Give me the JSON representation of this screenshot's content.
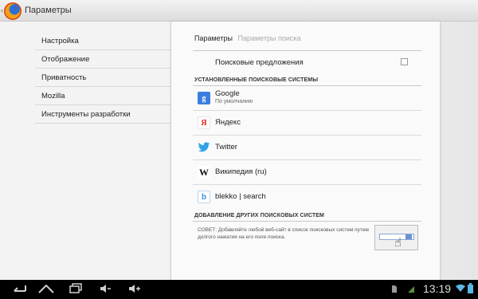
{
  "actionbar": {
    "title": "Параметры",
    "up_icon": "chevron-left-icon",
    "logo_icon": "firefox-logo-icon"
  },
  "nav": {
    "items": [
      {
        "label": "Настройка"
      },
      {
        "label": "Отображение"
      },
      {
        "label": "Приватность"
      },
      {
        "label": "Mozilla"
      },
      {
        "label": "Инструменты разработки"
      }
    ]
  },
  "panel": {
    "breadcrumb": {
      "current": "Параметры",
      "child": "Параметры поиска"
    },
    "suggestions": {
      "label": "Поисковые предложения",
      "checked": false
    },
    "installed_header": "УСТАНОВЛЕННЫЕ ПОИСКОВЫЕ СИСТЕМЫ",
    "engines": [
      {
        "name": "Google",
        "sub": "По умолчанию",
        "icon": "google-icon",
        "glyph": "g"
      },
      {
        "name": "Яндекс",
        "sub": "",
        "icon": "yandex-icon",
        "glyph": "Я"
      },
      {
        "name": "Twitter",
        "sub": "",
        "icon": "twitter-icon",
        "glyph": "🐦"
      },
      {
        "name": "Википедия (ru)",
        "sub": "",
        "icon": "wikipedia-icon",
        "glyph": "W"
      },
      {
        "name": "blekko | search",
        "sub": "",
        "icon": "blekko-icon",
        "glyph": "b"
      }
    ],
    "add_header": "ДОБАВЛЕНИЕ ДРУГИХ ПОИСКОВЫХ СИСТЕМ",
    "tip": "СОВЕТ: Добавляйте любой веб-сайт в список поисковых систем путем долгого нажатия на его поле поиска.",
    "tip_illustration": "long-press-search-illustration"
  },
  "systembar": {
    "icons": [
      "back-icon",
      "home-icon",
      "recent-apps-icon",
      "volume-down-icon",
      "volume-up-icon",
      "sd-card-icon",
      "signal-icon",
      "wifi-icon",
      "battery-icon"
    ],
    "time": "13:19"
  },
  "colors": {
    "accent": "#2fa3e6",
    "google_blue": "#3b7de0",
    "yandex_red": "#e0261e"
  }
}
